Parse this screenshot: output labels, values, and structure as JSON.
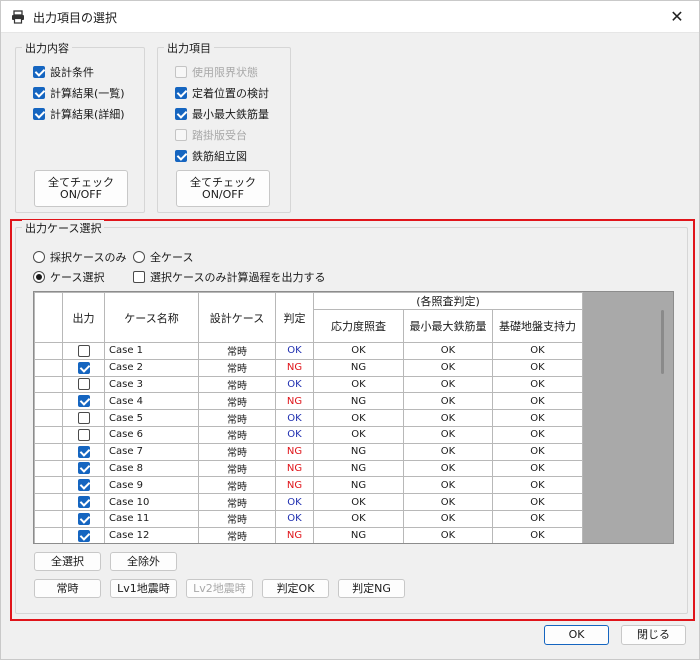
{
  "window": {
    "title": "出力項目の選択",
    "icon": "printer-icon",
    "close_icon": "close-icon"
  },
  "output_content": {
    "label": "出力内容",
    "items": [
      {
        "label": "設計条件",
        "checked": true,
        "enabled": true
      },
      {
        "label": "計算結果(一覧)",
        "checked": true,
        "enabled": true
      },
      {
        "label": "計算結果(詳細)",
        "checked": true,
        "enabled": true
      }
    ],
    "toggle_button": "全てチェック\nON/OFF"
  },
  "output_items": {
    "label": "出力項目",
    "items": [
      {
        "label": "使用限界状態",
        "checked": false,
        "enabled": false
      },
      {
        "label": "定着位置の検討",
        "checked": true,
        "enabled": true
      },
      {
        "label": "最小最大鉄筋量",
        "checked": true,
        "enabled": true
      },
      {
        "label": "踏掛版受台",
        "checked": false,
        "enabled": false
      },
      {
        "label": "鉄筋組立図",
        "checked": true,
        "enabled": true
      }
    ],
    "toggle_button": "全てチェック\nON/OFF"
  },
  "case_selection": {
    "label": "出力ケース選択",
    "radio_adopted": "採択ケースのみ",
    "radio_all": "全ケース",
    "radio_case": "ケース選択",
    "selected_radio": "ケース選択",
    "calc_process_label": "選択ケースのみ計算過程を出力する",
    "calc_process_checked": false
  },
  "grid": {
    "headers": {
      "output": "出力",
      "case_name": "ケース名称",
      "design_case": "設計ケース",
      "judgement": "判定",
      "group": "(各照査判定)",
      "stress": "応力度照査",
      "rebar": "最小最大鉄筋量",
      "foundation": "基礎地盤支持力"
    },
    "rows": [
      {
        "checked": false,
        "name": "Case 1",
        "design": "常時",
        "judge": "OK",
        "stress": "OK",
        "rebar": "OK",
        "foundation": "OK"
      },
      {
        "checked": true,
        "name": "Case 2",
        "design": "常時",
        "judge": "NG",
        "stress": "NG",
        "rebar": "OK",
        "foundation": "OK"
      },
      {
        "checked": false,
        "name": "Case 3",
        "design": "常時",
        "judge": "OK",
        "stress": "OK",
        "rebar": "OK",
        "foundation": "OK"
      },
      {
        "checked": true,
        "name": "Case 4",
        "design": "常時",
        "judge": "NG",
        "stress": "NG",
        "rebar": "OK",
        "foundation": "OK"
      },
      {
        "checked": false,
        "name": "Case 5",
        "design": "常時",
        "judge": "OK",
        "stress": "OK",
        "rebar": "OK",
        "foundation": "OK"
      },
      {
        "checked": false,
        "name": "Case 6",
        "design": "常時",
        "judge": "OK",
        "stress": "OK",
        "rebar": "OK",
        "foundation": "OK"
      },
      {
        "checked": true,
        "name": "Case 7",
        "design": "常時",
        "judge": "NG",
        "stress": "NG",
        "rebar": "OK",
        "foundation": "OK"
      },
      {
        "checked": true,
        "name": "Case 8",
        "design": "常時",
        "judge": "NG",
        "stress": "NG",
        "rebar": "OK",
        "foundation": "OK"
      },
      {
        "checked": true,
        "name": "Case 9",
        "design": "常時",
        "judge": "NG",
        "stress": "NG",
        "rebar": "OK",
        "foundation": "OK"
      },
      {
        "checked": true,
        "name": "Case 10",
        "design": "常時",
        "judge": "OK",
        "stress": "OK",
        "rebar": "OK",
        "foundation": "OK"
      },
      {
        "checked": true,
        "name": "Case 11",
        "design": "常時",
        "judge": "OK",
        "stress": "OK",
        "rebar": "OK",
        "foundation": "OK"
      },
      {
        "checked": true,
        "name": "Case 12",
        "design": "常時",
        "judge": "NG",
        "stress": "NG",
        "rebar": "OK",
        "foundation": "OK"
      }
    ]
  },
  "buttons": {
    "select_all": "全選択",
    "deselect_all": "全除外",
    "normal": "常時",
    "lv1": "Lv1地震時",
    "lv2": "Lv2地震時",
    "judge_ok": "判定OK",
    "judge_ng": "判定NG",
    "ok": "OK",
    "close": "閉じる"
  },
  "colors": {
    "accent": "#1565c0",
    "highlight_frame": "#e0141a",
    "ok_text": "#1f2fb0",
    "ng_text": "#e0141a"
  }
}
